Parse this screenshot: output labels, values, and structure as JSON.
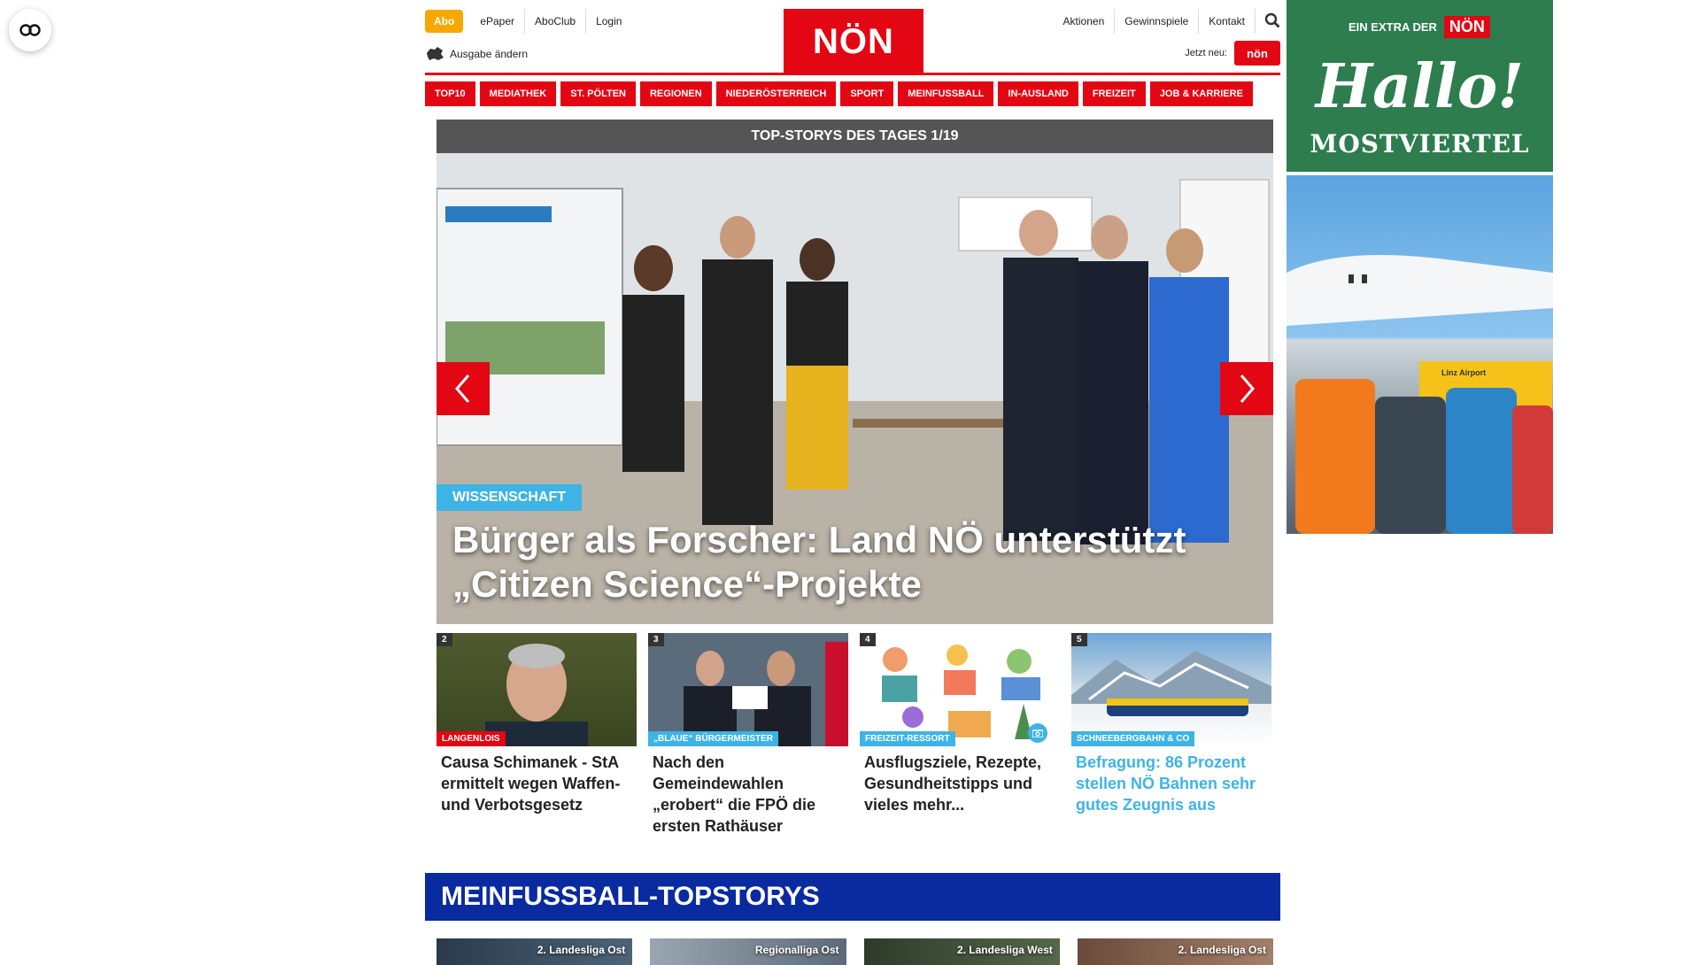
{
  "header": {
    "abo": "Abo",
    "links_left": [
      "ePaper",
      "AboClub",
      "Login"
    ],
    "ausgabe": "Ausgabe ändern",
    "logo": "NÖN",
    "links_right": [
      "Aktionen",
      "Gewinnspiele",
      "Kontakt"
    ],
    "jetzt_neu": "Jetzt neu:",
    "jetzt_logo": "nön"
  },
  "nav": [
    "TOP10",
    "MEDIATHEK",
    "ST. PÖLTEN",
    "REGIONEN",
    "NIEDERÖSTERREICH",
    "SPORT",
    "MEINFUSSBALL",
    "IN-AUSLAND",
    "FREIZEIT",
    "JOB & KARRIERE"
  ],
  "top_stories": {
    "header": "TOP-STORYS DES TAGES 1/19",
    "hero_tag": "WISSENSCHAFT",
    "hero_title": "Bürger als Forscher: Land NÖ unterstützt „Citizen Science“-Projekte",
    "cards": [
      {
        "num": "2",
        "tag": "LANGENLOIS",
        "tag_color": "#e30613",
        "title": "Causa Schimanek - StA ermittelt wegen Waffen- und Verbotsgesetz",
        "title_color": "#222222"
      },
      {
        "num": "3",
        "tag": "„BLAUE“ BÜRGERMEISTER",
        "tag_color": "#3db4e5",
        "title": "Nach den Gemeindewahlen „erobert“ die FPÖ die ersten Rathäuser",
        "title_color": "#222222"
      },
      {
        "num": "4",
        "tag": "FREIZEIT-RESSORT",
        "tag_color": "#3db4e5",
        "title": "Ausflugsziele, Rezepte, Gesundheitstipps und vieles mehr...",
        "title_color": "#222222"
      },
      {
        "num": "5",
        "tag": "SCHNEEBERGBAHN & CO",
        "tag_color": "#3db4e5",
        "title": "Befragung: 86 Prozent stellen NÖ Bahnen sehr gutes Zeugnis aus",
        "title_color": "#3db4e5"
      }
    ]
  },
  "meinfussball": {
    "header": "MEINFUSSBALL-TOPSTORYS",
    "cards": [
      "2. Landesliga Ost",
      "Regionalliga Ost",
      "2. Landesliga West",
      "2. Landesliga Ost"
    ]
  },
  "ad": {
    "extra": "EIN EXTRA DER",
    "extra_logo": "NÖN",
    "hallo": "Hallo!",
    "region": "MOSTVIERTEL",
    "sign": "Linz Airport"
  },
  "colors": {
    "brand_red": "#e30613",
    "accent_blue": "#3db4e5",
    "fussball_blue": "#0a2aa0",
    "abo_orange": "#f5a800"
  }
}
